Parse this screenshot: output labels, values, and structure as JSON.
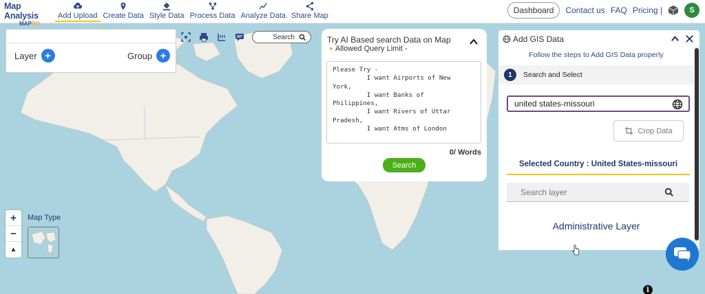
{
  "app": {
    "logo_line1": "Map Analysis",
    "logo_line2_a": "MAP",
    "logo_line2_b": "RO"
  },
  "nav": {
    "items": [
      {
        "label": "Add Upload",
        "icon": "cloud-upload-icon",
        "active": true
      },
      {
        "label": "Create Data",
        "icon": "map-pin-icon"
      },
      {
        "label": "Style Data",
        "icon": "paint-bucket-icon"
      },
      {
        "label": "Process Data",
        "icon": "process-icon"
      },
      {
        "label": "Analyze Data",
        "icon": "analyze-icon"
      },
      {
        "label": "Share Map",
        "icon": "share-icon"
      }
    ],
    "dashboard": "Dashboard",
    "contact": "Contact us",
    "faq": "FAQ",
    "pricing": "Pricing |",
    "avatar_initial": "S"
  },
  "layer_panel": {
    "layer_label": "Layer",
    "group_label": "Group"
  },
  "toolbar": {
    "search_label": "Search"
  },
  "ai_panel": {
    "title": "Try AI Based search Data on Map",
    "subtitle": "Allowed Query Limit -",
    "placeholder_text": "Please Try -\n         I want Airports of New\nYork,\n         I want Banks of\nPhilippines,\n         I want Rivers of Uttar\nPradesh,\n         I want Atms of London",
    "word_count": "0/ Words",
    "search_button": "Search"
  },
  "gis_panel": {
    "title": "Add GIS Data",
    "follow_text": "Follow the steps to Add GIS Data properly",
    "step_number": "1",
    "step_label": "Search and Select",
    "country_input_value": "united states-missouri",
    "crop_button": "Crop Data",
    "selected_country": "Selected Country : United States-missouri",
    "layer_search_placeholder": "Search layer",
    "admin_layer": "Administrative Layer"
  },
  "map": {
    "zoom_in": "+",
    "zoom_out": "−",
    "compass": "▲",
    "map_type_label": "Map Type"
  },
  "colors": {
    "brand_blue": "#2e4a8a",
    "accent_yellow": "#f5c518",
    "search_green": "#4caf1a",
    "ocean": "#aad3df",
    "land": "#f2efe9"
  }
}
